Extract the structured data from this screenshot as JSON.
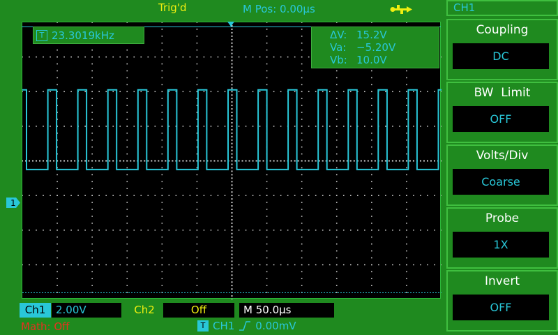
{
  "header": {
    "trig_status": "Trig'd",
    "mpos": "M Pos: 0.00μs",
    "usb_icon": "usb-icon"
  },
  "measure": {
    "freq_icon": "T",
    "frequency": "23.3019kHz"
  },
  "cursors": {
    "dv_label": "ΔV:",
    "dv_value": "15.2V",
    "va_label": "Va:",
    "va_value": "−5.20V",
    "vb_label": "Vb:",
    "vb_value": "10.0V"
  },
  "channel_marker": "1",
  "menu": {
    "title": "CH1",
    "items": [
      {
        "label": "Coupling",
        "value": "DC"
      },
      {
        "label": "BW  Limit",
        "value": "OFF"
      },
      {
        "label": "Volts/Div",
        "value": "Coarse"
      },
      {
        "label": "Probe",
        "value": "1X"
      },
      {
        "label": "Invert",
        "value": "OFF"
      }
    ]
  },
  "status": {
    "ch1_label": "Ch1",
    "ch1_volts": "2.00V",
    "ch2_label": "Ch2",
    "ch2_value": "Off",
    "timebase": "M 50.0μs",
    "math": "Math: Off",
    "trig_source_icon": "T",
    "trig_source": "CH1",
    "trig_slope_icon": "rising-edge-icon",
    "trig_level": "0.00mV"
  },
  "colors": {
    "background": "#1f8a1f",
    "trace": "#29c7d8",
    "yellow": "#f0ef10",
    "math_red": "#e83020"
  },
  "waveform": {
    "type": "pulse-train",
    "period_divisions": 0.86,
    "high_divisions": 0.25,
    "low_level_div": -0.25,
    "high_level_div": 2.05
  }
}
